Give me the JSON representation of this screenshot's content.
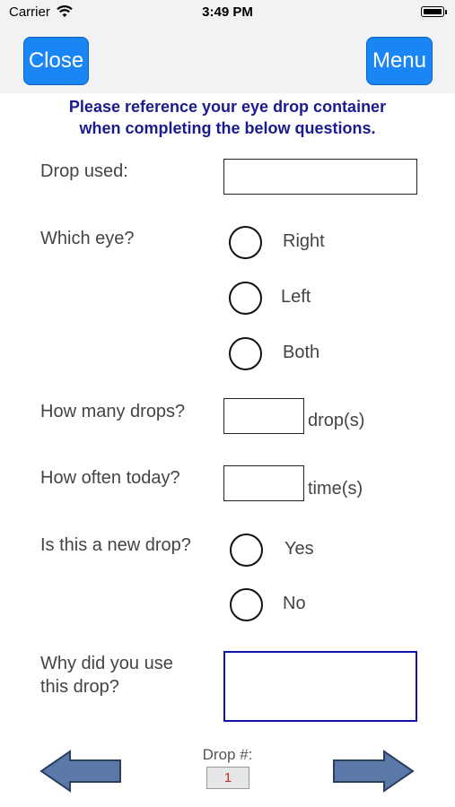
{
  "status_bar": {
    "carrier": "Carrier",
    "time": "3:49 PM"
  },
  "nav": {
    "close_label": "Close",
    "menu_label": "Menu",
    "button_color": "#1a86f5"
  },
  "instruction": {
    "line1": "Please reference your eye drop container",
    "line2": "when completing the below questions."
  },
  "form": {
    "drop_used": {
      "label": "Drop used:",
      "value": ""
    },
    "which_eye": {
      "label": "Which eye?",
      "options": [
        "Right",
        "Left",
        "Both"
      ],
      "selected": null
    },
    "how_many": {
      "label": "How many drops?",
      "value": "",
      "unit": "drop(s)"
    },
    "how_often": {
      "label": "How often today?",
      "value": "",
      "unit": "time(s)"
    },
    "new_drop": {
      "label": "Is this a new drop?",
      "options": [
        "Yes",
        "No"
      ],
      "selected": null
    },
    "why": {
      "label_line1": "Why did you use",
      "label_line2": "this drop?",
      "value": ""
    }
  },
  "footer": {
    "drop_label": "Drop #:",
    "drop_number": "1",
    "arrow_color": "#5b79a8"
  }
}
